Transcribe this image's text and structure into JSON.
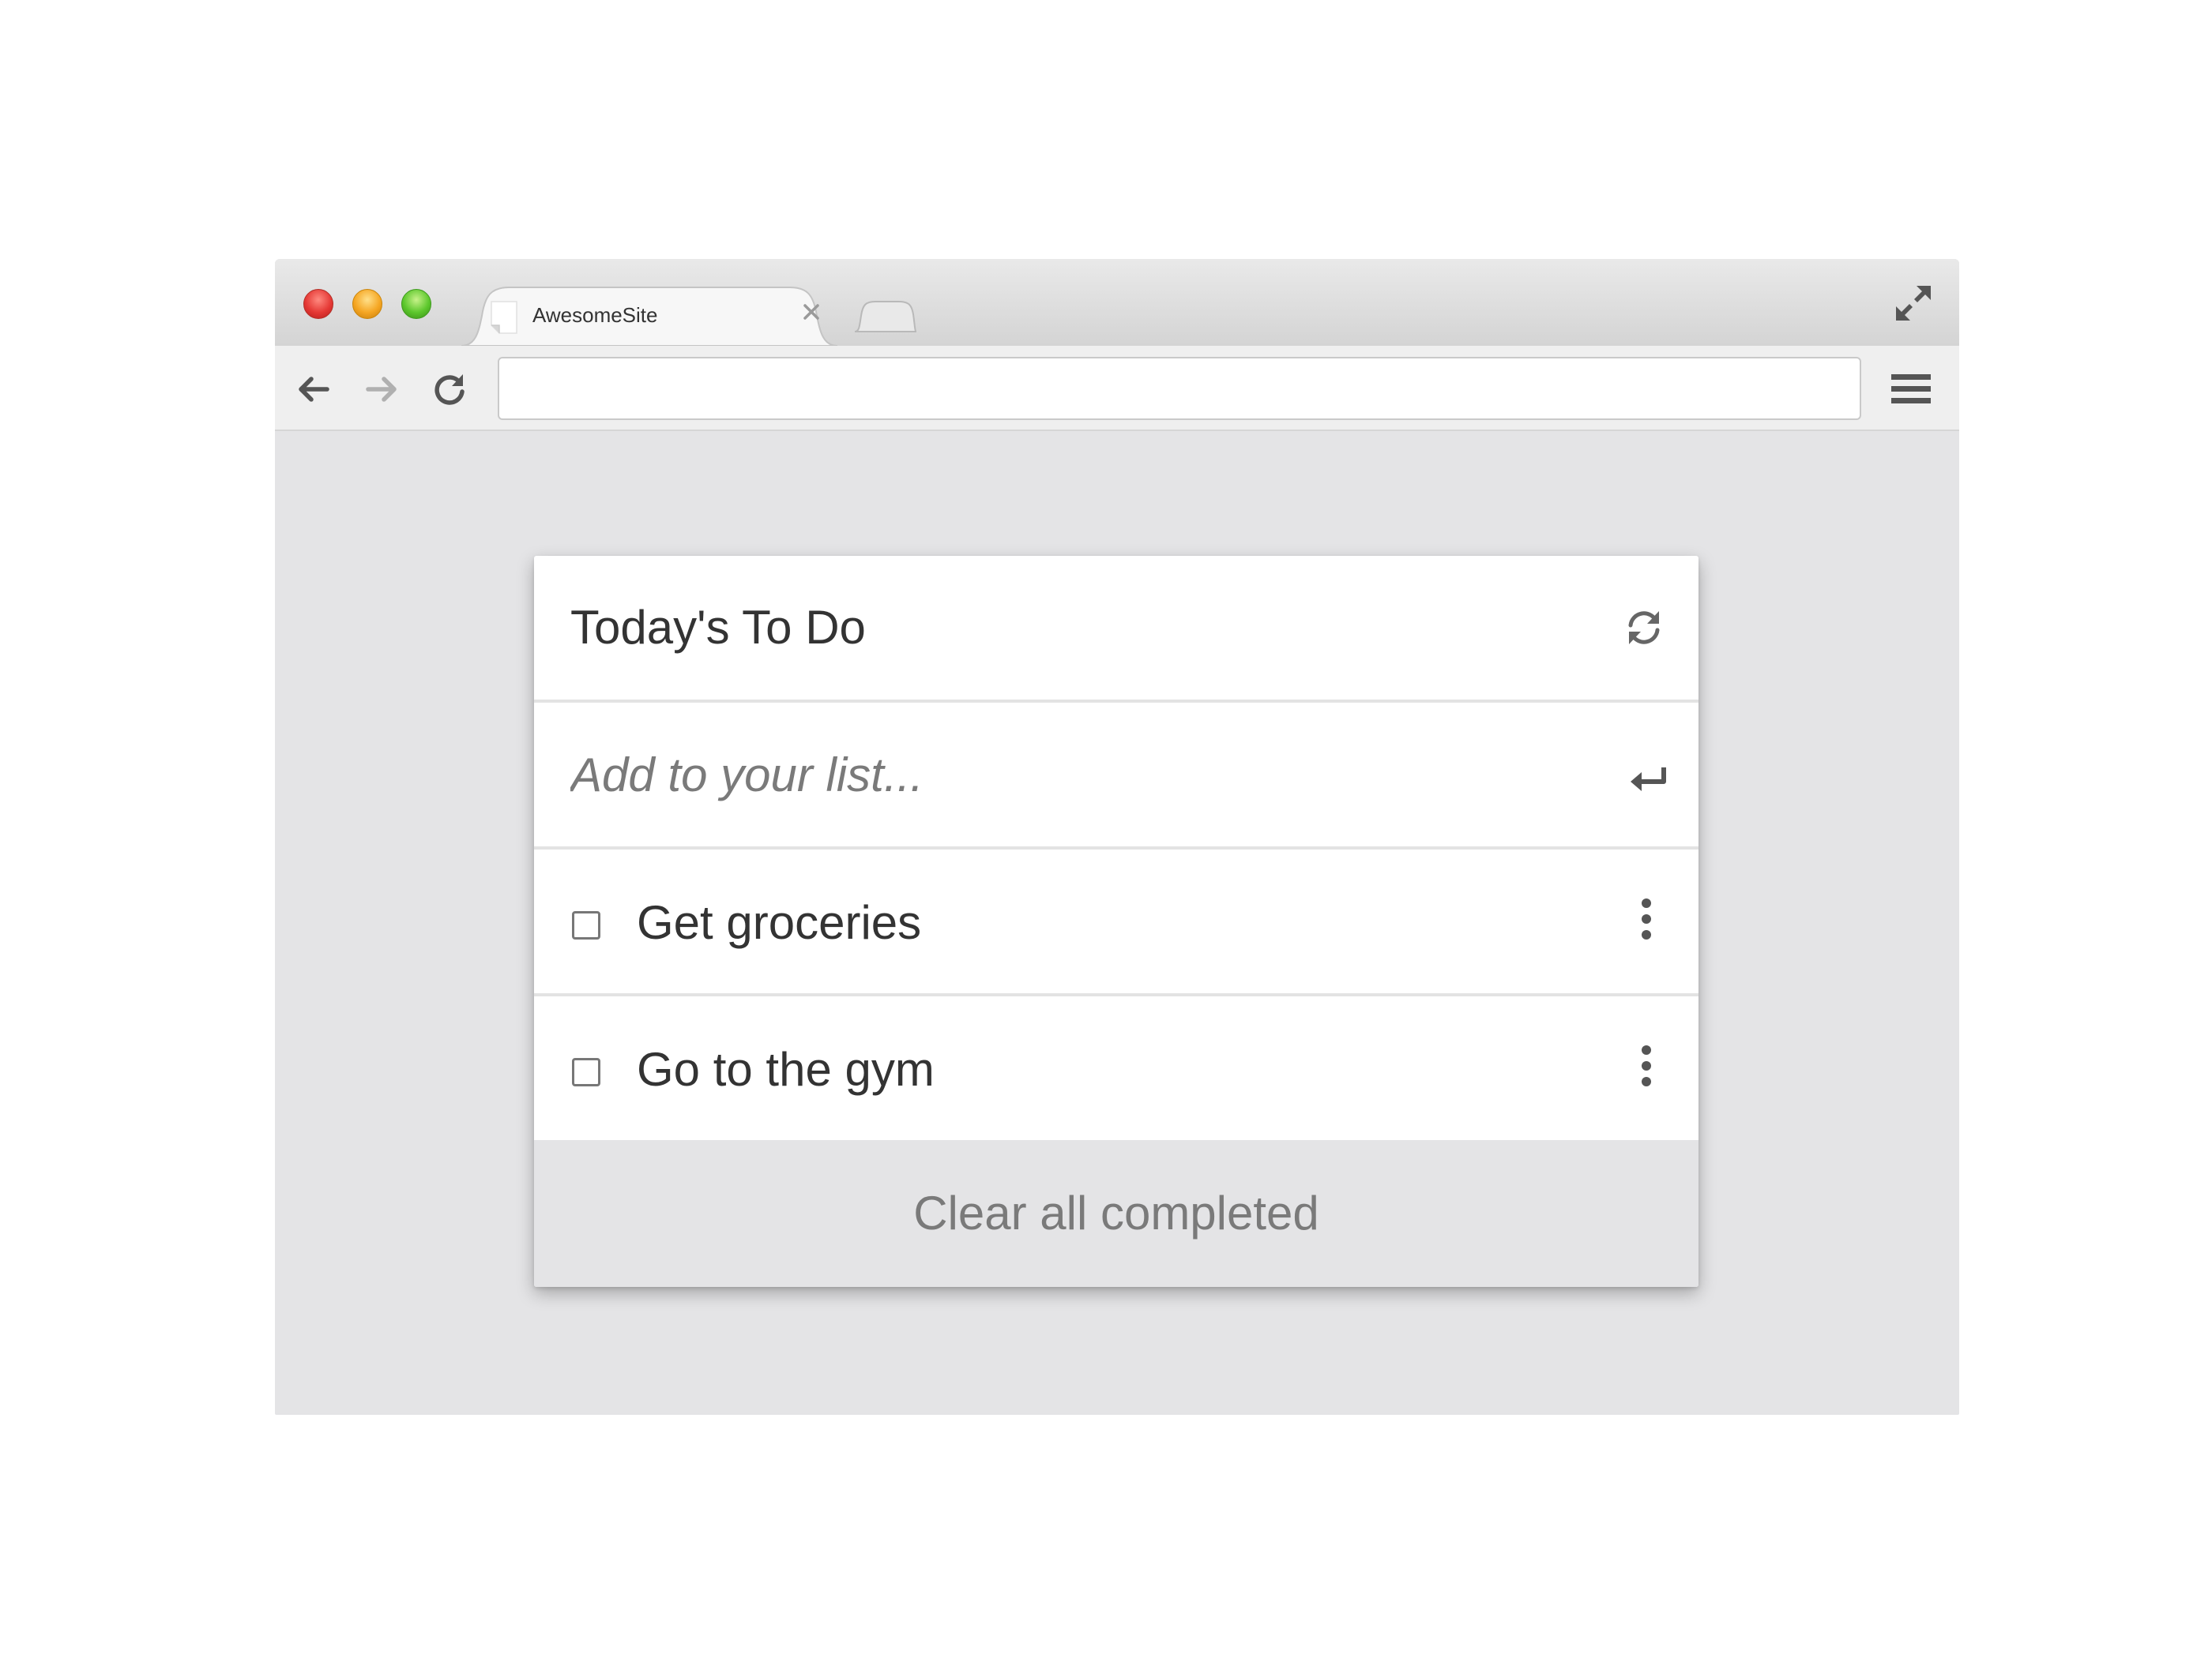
{
  "browser": {
    "tab": {
      "title": "AwesomeSite",
      "favicon": "blank-page-icon",
      "close_icon": "close-icon"
    },
    "new_tab_icon": "new-tab-icon",
    "fullscreen_icon": "fullscreen-icon",
    "toolbar": {
      "back_icon": "arrow-left-icon",
      "forward_icon": "arrow-right-icon",
      "reload_icon": "reload-icon",
      "address_value": "",
      "menu_icon": "hamburger-menu-icon"
    },
    "traffic_lights": {
      "close_color": "#e53935",
      "minimize_color": "#f5a623",
      "zoom_color": "#5cc72c"
    }
  },
  "todo": {
    "title": "Today's To Do",
    "refresh_icon": "refresh-icon",
    "input_placeholder": "Add to your list...",
    "input_value": "",
    "enter_icon": "enter-icon",
    "items": [
      {
        "label": "Get groceries",
        "checked": false,
        "menu_icon": "more-vertical-icon"
      },
      {
        "label": "Go to the gym",
        "checked": false,
        "menu_icon": "more-vertical-icon"
      }
    ],
    "clear_label": "Clear all completed"
  },
  "colors": {
    "page_background": "#e4e4e6",
    "card_background": "#ffffff",
    "text": "#333333",
    "muted_text": "#7a7a7a"
  }
}
